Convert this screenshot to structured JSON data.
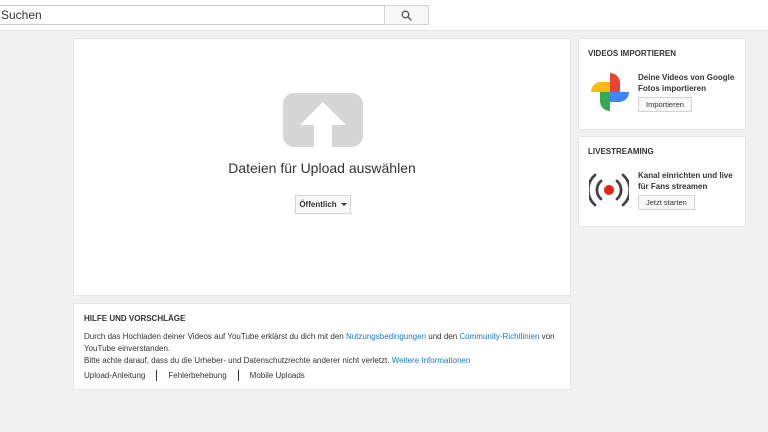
{
  "search": {
    "placeholder": "Suchen",
    "button_icon": "search-icon"
  },
  "upload": {
    "icon": "upload-arrow-icon",
    "title": "Dateien für Upload auswählen",
    "privacy": "Öffentlich"
  },
  "help": {
    "title": "HILFE UND VORSCHLÄGE",
    "line1_part1": "Durch das Hochladen deiner Videos auf YouTube erklärst du dich mit den ",
    "terms_link": "Nutzungsbedingungen",
    "line1_part2": " und den ",
    "guidelines_link": "Community-Richtlinien",
    "line1_part3": " von YouTube einverstanden.",
    "line2": "Bitte achte darauf, dass du die Urheber- und Datenschutzrechte anderer nicht verletzt. ",
    "more_link": "Weitere Informationen",
    "links": [
      "Upload-Anleitung",
      "Fehlerbehebung",
      "Mobile Uploads"
    ]
  },
  "import": {
    "title": "VIDEOS IMPORTIEREN",
    "icon": "google-photos-icon",
    "text": "Deine Videos von Google Fotos importieren",
    "button": "Importieren"
  },
  "livestream": {
    "title": "LIVESTREAMING",
    "icon": "live-broadcast-icon",
    "text": "Kanal einrichten und live für Fans streamen",
    "button": "Jetzt starten"
  },
  "colors": {
    "link": "#167ac6",
    "live_red": "#e62117",
    "background": "#f1f1f1"
  }
}
